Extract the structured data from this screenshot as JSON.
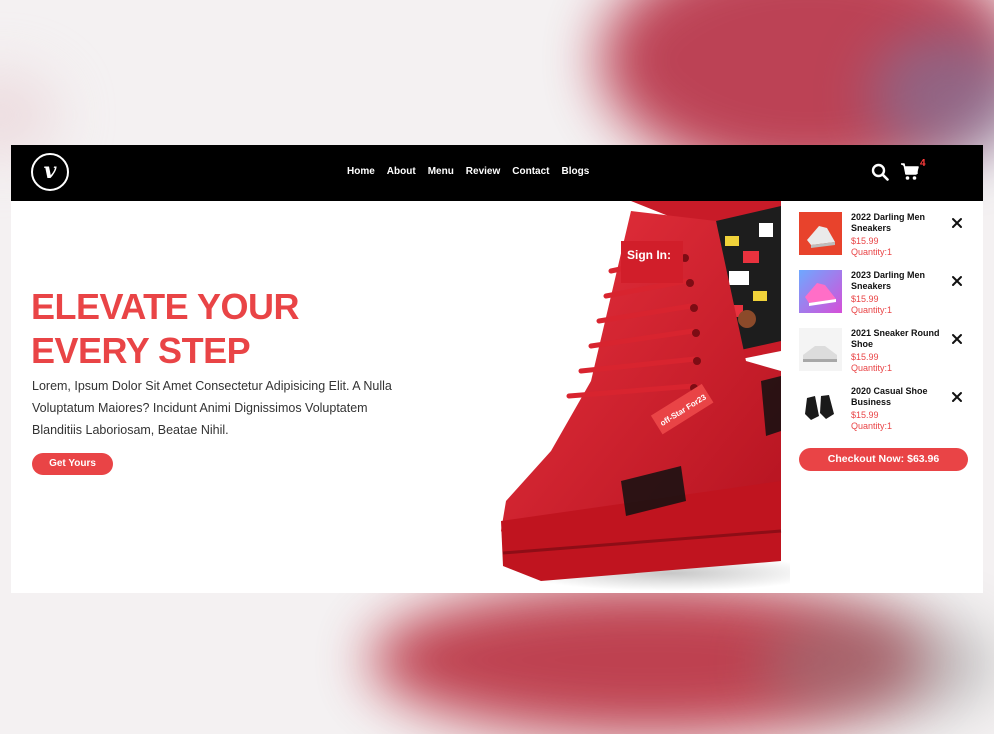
{
  "brand": {
    "logo_letter": "v",
    "logo_icon": "vimeo-icon"
  },
  "nav": {
    "items": [
      {
        "label": "Home"
      },
      {
        "label": "About"
      },
      {
        "label": "Menu"
      },
      {
        "label": "Review"
      },
      {
        "label": "Contact"
      },
      {
        "label": "Blogs"
      }
    ]
  },
  "header_actions": {
    "search_icon": "search-icon",
    "cart_icon": "cart-icon",
    "cart_count": "4"
  },
  "hero": {
    "title_line1": "ELEVATE YOUR",
    "title_line2": "EVERY STEP",
    "description": "Lorem, Ipsum Dolor Sit Amet Consectetur Adipisicing Elit. A Nulla Voluptatum Maiores? Incidunt Animi Dignissimos Voluptatem Blanditiis Laboriosam, Beatae Nihil.",
    "cta_label": "Get Yours",
    "shoe_tag_text": "off-Star For23",
    "shoe_label_text": "Sign In:"
  },
  "cart": {
    "items": [
      {
        "name": "2022 Darling Men Sneakers",
        "price": "$15.99",
        "quantity": "Quantity:1"
      },
      {
        "name": "2023 Darling Men Sneakers",
        "price": "$15.99",
        "quantity": "Quantity:1"
      },
      {
        "name": "2021 Sneaker Round Shoe",
        "price": "$15.99",
        "quantity": "Quantity:1"
      },
      {
        "name": "2020 Casual Shoe Business",
        "price": "$15.99",
        "quantity": "Quantity:1"
      }
    ],
    "checkout_label": "Checkout Now: $63.96"
  },
  "colors": {
    "accent": "#e94446",
    "header_bg": "#000000",
    "text": "#333333"
  }
}
